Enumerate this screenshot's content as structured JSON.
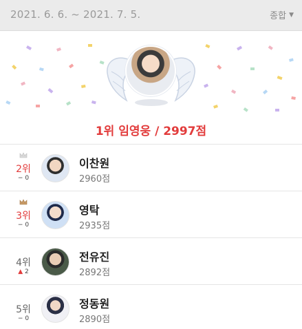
{
  "header": {
    "date_range": "2021. 6. 6. ~ 2021. 7. 5.",
    "filter_label": "종합",
    "filter_icon": "caret-down-icon"
  },
  "winner": {
    "text": "1위 임영웅 / 2997점",
    "accent_color": "#e23c3c"
  },
  "ranking": [
    {
      "rank": "2위",
      "change": "0",
      "change_icon": "dash-icon",
      "name": "이찬원",
      "score": "2960점",
      "crown": "silver-crown-icon",
      "rank_color": "#e23c3c"
    },
    {
      "rank": "3위",
      "change": "0",
      "change_icon": "dash-icon",
      "name": "영탁",
      "score": "2935점",
      "crown": "bronze-crown-icon",
      "rank_color": "#e23c3c"
    },
    {
      "rank": "4위",
      "change": "2",
      "change_icon": "up-arrow-icon",
      "name": "전유진",
      "score": "2892점",
      "crown": "",
      "rank_color": "#666666"
    },
    {
      "rank": "5위",
      "change": "0",
      "change_icon": "dash-icon",
      "name": "정동원",
      "score": "2890점",
      "crown": "",
      "rank_color": "#666666"
    }
  ]
}
